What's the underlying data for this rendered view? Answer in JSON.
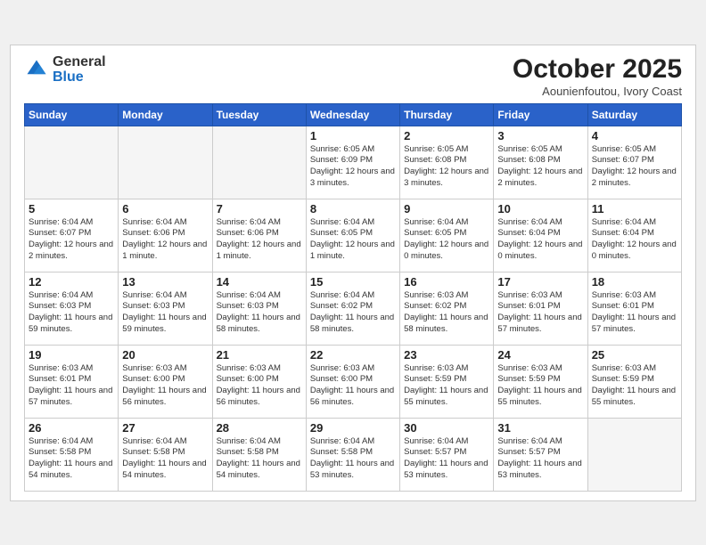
{
  "logo": {
    "general": "General",
    "blue": "Blue"
  },
  "title": "October 2025",
  "subtitle": "Aounienfoutou, Ivory Coast",
  "headers": [
    "Sunday",
    "Monday",
    "Tuesday",
    "Wednesday",
    "Thursday",
    "Friday",
    "Saturday"
  ],
  "weeks": [
    [
      {
        "day": "",
        "info": ""
      },
      {
        "day": "",
        "info": ""
      },
      {
        "day": "",
        "info": ""
      },
      {
        "day": "1",
        "info": "Sunrise: 6:05 AM\nSunset: 6:09 PM\nDaylight: 12 hours\nand 3 minutes."
      },
      {
        "day": "2",
        "info": "Sunrise: 6:05 AM\nSunset: 6:08 PM\nDaylight: 12 hours\nand 3 minutes."
      },
      {
        "day": "3",
        "info": "Sunrise: 6:05 AM\nSunset: 6:08 PM\nDaylight: 12 hours\nand 2 minutes."
      },
      {
        "day": "4",
        "info": "Sunrise: 6:05 AM\nSunset: 6:07 PM\nDaylight: 12 hours\nand 2 minutes."
      }
    ],
    [
      {
        "day": "5",
        "info": "Sunrise: 6:04 AM\nSunset: 6:07 PM\nDaylight: 12 hours\nand 2 minutes."
      },
      {
        "day": "6",
        "info": "Sunrise: 6:04 AM\nSunset: 6:06 PM\nDaylight: 12 hours\nand 1 minute."
      },
      {
        "day": "7",
        "info": "Sunrise: 6:04 AM\nSunset: 6:06 PM\nDaylight: 12 hours\nand 1 minute."
      },
      {
        "day": "8",
        "info": "Sunrise: 6:04 AM\nSunset: 6:05 PM\nDaylight: 12 hours\nand 1 minute."
      },
      {
        "day": "9",
        "info": "Sunrise: 6:04 AM\nSunset: 6:05 PM\nDaylight: 12 hours\nand 0 minutes."
      },
      {
        "day": "10",
        "info": "Sunrise: 6:04 AM\nSunset: 6:04 PM\nDaylight: 12 hours\nand 0 minutes."
      },
      {
        "day": "11",
        "info": "Sunrise: 6:04 AM\nSunset: 6:04 PM\nDaylight: 12 hours\nand 0 minutes."
      }
    ],
    [
      {
        "day": "12",
        "info": "Sunrise: 6:04 AM\nSunset: 6:03 PM\nDaylight: 11 hours\nand 59 minutes."
      },
      {
        "day": "13",
        "info": "Sunrise: 6:04 AM\nSunset: 6:03 PM\nDaylight: 11 hours\nand 59 minutes."
      },
      {
        "day": "14",
        "info": "Sunrise: 6:04 AM\nSunset: 6:03 PM\nDaylight: 11 hours\nand 58 minutes."
      },
      {
        "day": "15",
        "info": "Sunrise: 6:04 AM\nSunset: 6:02 PM\nDaylight: 11 hours\nand 58 minutes."
      },
      {
        "day": "16",
        "info": "Sunrise: 6:03 AM\nSunset: 6:02 PM\nDaylight: 11 hours\nand 58 minutes."
      },
      {
        "day": "17",
        "info": "Sunrise: 6:03 AM\nSunset: 6:01 PM\nDaylight: 11 hours\nand 57 minutes."
      },
      {
        "day": "18",
        "info": "Sunrise: 6:03 AM\nSunset: 6:01 PM\nDaylight: 11 hours\nand 57 minutes."
      }
    ],
    [
      {
        "day": "19",
        "info": "Sunrise: 6:03 AM\nSunset: 6:01 PM\nDaylight: 11 hours\nand 57 minutes."
      },
      {
        "day": "20",
        "info": "Sunrise: 6:03 AM\nSunset: 6:00 PM\nDaylight: 11 hours\nand 56 minutes."
      },
      {
        "day": "21",
        "info": "Sunrise: 6:03 AM\nSunset: 6:00 PM\nDaylight: 11 hours\nand 56 minutes."
      },
      {
        "day": "22",
        "info": "Sunrise: 6:03 AM\nSunset: 6:00 PM\nDaylight: 11 hours\nand 56 minutes."
      },
      {
        "day": "23",
        "info": "Sunrise: 6:03 AM\nSunset: 5:59 PM\nDaylight: 11 hours\nand 55 minutes."
      },
      {
        "day": "24",
        "info": "Sunrise: 6:03 AM\nSunset: 5:59 PM\nDaylight: 11 hours\nand 55 minutes."
      },
      {
        "day": "25",
        "info": "Sunrise: 6:03 AM\nSunset: 5:59 PM\nDaylight: 11 hours\nand 55 minutes."
      }
    ],
    [
      {
        "day": "26",
        "info": "Sunrise: 6:04 AM\nSunset: 5:58 PM\nDaylight: 11 hours\nand 54 minutes."
      },
      {
        "day": "27",
        "info": "Sunrise: 6:04 AM\nSunset: 5:58 PM\nDaylight: 11 hours\nand 54 minutes."
      },
      {
        "day": "28",
        "info": "Sunrise: 6:04 AM\nSunset: 5:58 PM\nDaylight: 11 hours\nand 54 minutes."
      },
      {
        "day": "29",
        "info": "Sunrise: 6:04 AM\nSunset: 5:58 PM\nDaylight: 11 hours\nand 53 minutes."
      },
      {
        "day": "30",
        "info": "Sunrise: 6:04 AM\nSunset: 5:57 PM\nDaylight: 11 hours\nand 53 minutes."
      },
      {
        "day": "31",
        "info": "Sunrise: 6:04 AM\nSunset: 5:57 PM\nDaylight: 11 hours\nand 53 minutes."
      },
      {
        "day": "",
        "info": ""
      }
    ]
  ]
}
